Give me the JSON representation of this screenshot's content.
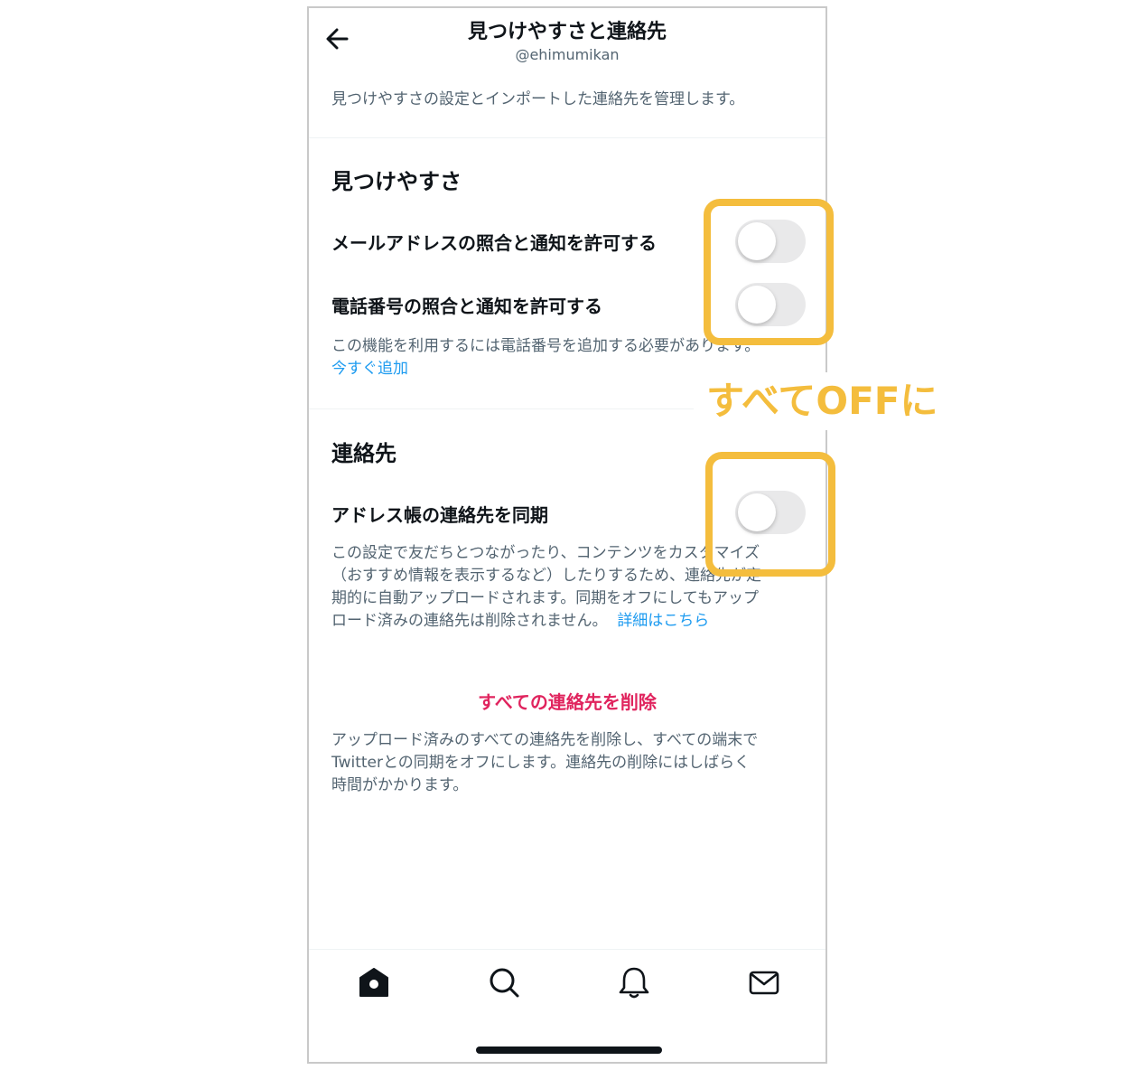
{
  "header": {
    "title": "見つけやすさと連絡先",
    "handle": "@ehimumikan"
  },
  "intro": "見つけやすさの設定とインポートした連絡先を管理します。",
  "discoverability": {
    "title": "見つけやすさ",
    "email_label": "メールアドレスの照合と通知を許可する",
    "email_enabled": false,
    "phone_label": "電話番号の照合と通知を許可する",
    "phone_enabled": false,
    "note": "この機能を利用するには電話番号を追加する必要があります。",
    "add_link": "今すぐ追加"
  },
  "contacts": {
    "title": "連絡先",
    "sync_label": "アドレス帳の連絡先を同期",
    "sync_enabled": false,
    "note_lines": [
      "この設定で友だちとつながったり、コンテンツをカスタマイズ",
      "（おすすめ情報を表示するなど）したりするため、連絡先が定",
      "期的に自動アップロードされます。同期をオフにしてもアップ",
      "ロード済みの連絡先は削除されません。"
    ],
    "details_link": "詳細はこちら",
    "delete_label": "すべての連絡先を削除",
    "delete_note_lines": [
      "アップロード済みのすべての連絡先を削除し、すべての端末で",
      "Twitterとの同期をオフにします。連絡先の削除にはしばらく",
      "時間がかかります。"
    ]
  },
  "annotation": {
    "text": "すべてOFFに",
    "color": "#f4bd3d"
  },
  "tabs": [
    "home-icon",
    "search-icon",
    "bell-icon",
    "mail-icon"
  ]
}
